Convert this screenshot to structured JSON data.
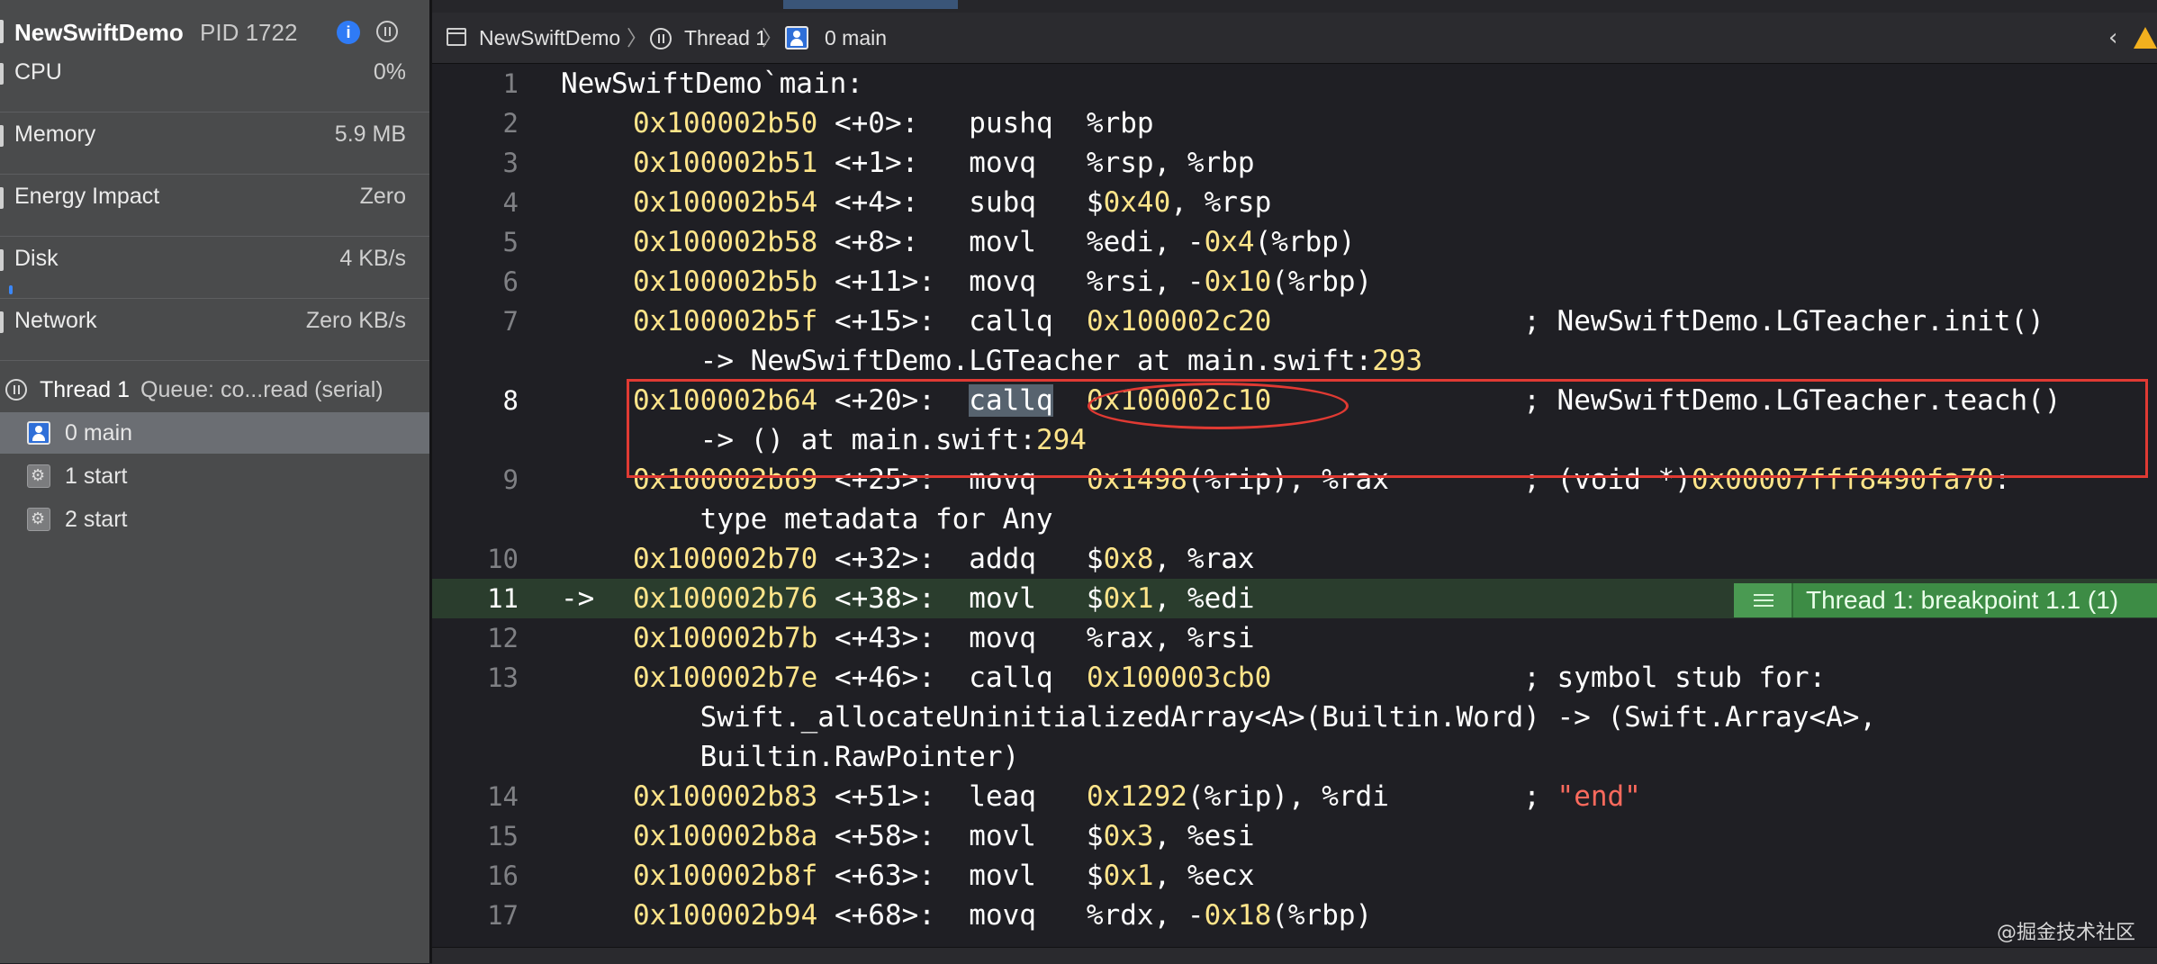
{
  "process": {
    "name": "NewSwiftDemo",
    "pid_label": "PID 1722"
  },
  "gauges": [
    {
      "label": "CPU",
      "value": "0%",
      "fill": 0.0
    },
    {
      "label": "Memory",
      "value": "5.9 MB",
      "fill": 0.0
    },
    {
      "label": "Energy Impact",
      "value": "Zero",
      "fill": 0.0
    },
    {
      "label": "Disk",
      "value": "4 KB/s",
      "fill": 0.01
    },
    {
      "label": "Network",
      "value": "Zero KB/s",
      "fill": 0.0
    }
  ],
  "thread": {
    "name": "Thread 1",
    "queue": "Queue: co...read (serial)"
  },
  "frames": [
    {
      "label": "0 main",
      "icon": "user-frame-icon",
      "selected": true
    },
    {
      "label": "1 start",
      "icon": "system-frame-icon",
      "selected": false
    },
    {
      "label": "2 start",
      "icon": "system-frame-icon",
      "selected": false
    }
  ],
  "jumpbar": {
    "file": "NewSwiftDemo",
    "thread": "Thread 1",
    "frame": "0 main"
  },
  "breakpoint_banner": "Thread 1: breakpoint 1.1 (1)",
  "watermark": "@掘金技术社区",
  "colors": {
    "address": "#ffe58a",
    "string": "#fc6a5d",
    "breakpoint": "#3d8c45",
    "annotation": "#e03a33"
  },
  "lines": [
    {
      "n": "1",
      "parts": [
        [
          "plain",
          "NewSwiftDemo`main:"
        ]
      ],
      "indent": 0
    },
    {
      "n": "2",
      "parts": [
        [
          "addr",
          "0x100002b50"
        ],
        [
          "plain",
          " <+0>:   pushq  %rbp"
        ]
      ]
    },
    {
      "n": "3",
      "parts": [
        [
          "addr",
          "0x100002b51"
        ],
        [
          "plain",
          " <+1>:   movq   %rsp, %rbp"
        ]
      ]
    },
    {
      "n": "4",
      "parts": [
        [
          "addr",
          "0x100002b54"
        ],
        [
          "plain",
          " <+4>:   subq   $"
        ],
        [
          "addr",
          "0x40"
        ],
        [
          "plain",
          ", %rsp"
        ]
      ]
    },
    {
      "n": "5",
      "parts": [
        [
          "addr",
          "0x100002b58"
        ],
        [
          "plain",
          " <+8>:   movl   %edi, -"
        ],
        [
          "addr",
          "0x4"
        ],
        [
          "plain",
          "(%rbp)"
        ]
      ]
    },
    {
      "n": "6",
      "parts": [
        [
          "addr",
          "0x100002b5b"
        ],
        [
          "plain",
          " <+11>:  movq   %rsi, -"
        ],
        [
          "addr",
          "0x10"
        ],
        [
          "plain",
          "(%rbp)"
        ]
      ]
    },
    {
      "n": "7",
      "parts": [
        [
          "addr",
          "0x100002b5f"
        ],
        [
          "plain",
          " <+15>:  callq  "
        ],
        [
          "addr",
          "0x100002c20"
        ],
        [
          "plain",
          "               ; NewSwiftDemo.LGTeacher.init()"
        ]
      ]
    },
    {
      "n": "",
      "parts": [
        [
          "plain",
          "    -> NewSwiftDemo.LGTeacher at main.swift:"
        ],
        [
          "addr",
          "293"
        ]
      ]
    },
    {
      "n": "8",
      "parts": [
        [
          "addr",
          "0x100002b64"
        ],
        [
          "plain",
          " <+20>:  "
        ],
        [
          "sel",
          "callq"
        ],
        [
          "plain",
          "  "
        ],
        [
          "addr",
          "0x100002c10"
        ],
        [
          "plain",
          "               ; NewSwiftDemo.LGTeacher.teach()"
        ]
      ],
      "current": true
    },
    {
      "n": "",
      "parts": [
        [
          "plain",
          "    -> () at main.swift:"
        ],
        [
          "addr",
          "294"
        ]
      ]
    },
    {
      "n": "9",
      "parts": [
        [
          "addr",
          "0x100002b69"
        ],
        [
          "plain",
          " <+25>:  movq   "
        ],
        [
          "addr",
          "0x1498"
        ],
        [
          "plain",
          "(%rip), %rax        ; (void *)"
        ],
        [
          "addr",
          "0x00007fff8490fa70"
        ],
        [
          "plain",
          ":"
        ]
      ]
    },
    {
      "n": "",
      "parts": [
        [
          "plain",
          "    type metadata for Any"
        ]
      ]
    },
    {
      "n": "10",
      "parts": [
        [
          "addr",
          "0x100002b70"
        ],
        [
          "plain",
          " <+32>:  addq   $"
        ],
        [
          "addr",
          "0x8"
        ],
        [
          "plain",
          ", %rax"
        ]
      ]
    },
    {
      "n": "11",
      "parts": [
        [
          "addr",
          "0x100002b76"
        ],
        [
          "plain",
          " <+38>:  movl   $"
        ],
        [
          "addr",
          "0x1"
        ],
        [
          "plain",
          ", %edi"
        ]
      ],
      "pc": true
    },
    {
      "n": "12",
      "parts": [
        [
          "addr",
          "0x100002b7b"
        ],
        [
          "plain",
          " <+43>:  movq   %rax, %rsi"
        ]
      ]
    },
    {
      "n": "13",
      "parts": [
        [
          "addr",
          "0x100002b7e"
        ],
        [
          "plain",
          " <+46>:  callq  "
        ],
        [
          "addr",
          "0x100003cb0"
        ],
        [
          "plain",
          "               ; symbol stub for:"
        ]
      ]
    },
    {
      "n": "",
      "parts": [
        [
          "plain",
          "    Swift._allocateUninitializedArray<A>(Builtin.Word) -> (Swift.Array<A>,"
        ]
      ]
    },
    {
      "n": "",
      "parts": [
        [
          "plain",
          "    Builtin.RawPointer)"
        ]
      ]
    },
    {
      "n": "14",
      "parts": [
        [
          "addr",
          "0x100002b83"
        ],
        [
          "plain",
          " <+51>:  leaq   "
        ],
        [
          "addr",
          "0x1292"
        ],
        [
          "plain",
          "(%rip), %rdi        ; "
        ],
        [
          "str",
          "\"end\""
        ]
      ]
    },
    {
      "n": "15",
      "parts": [
        [
          "addr",
          "0x100002b8a"
        ],
        [
          "plain",
          " <+58>:  movl   $"
        ],
        [
          "addr",
          "0x3"
        ],
        [
          "plain",
          ", %esi"
        ]
      ]
    },
    {
      "n": "16",
      "parts": [
        [
          "addr",
          "0x100002b8f"
        ],
        [
          "plain",
          " <+63>:  movl   $"
        ],
        [
          "addr",
          "0x1"
        ],
        [
          "plain",
          ", %ecx"
        ]
      ]
    },
    {
      "n": "17",
      "parts": [
        [
          "addr",
          "0x100002b94"
        ],
        [
          "plain",
          " <+68>:  movq   %rdx, -"
        ],
        [
          "addr",
          "0x18"
        ],
        [
          "plain",
          "(%rbp)"
        ]
      ]
    }
  ],
  "pc_arrow": "->"
}
